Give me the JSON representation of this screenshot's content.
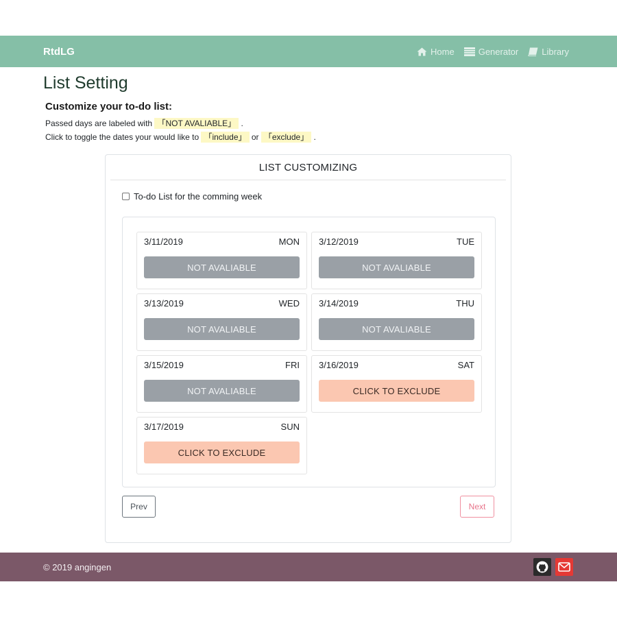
{
  "navbar": {
    "brand": "RtdLG",
    "links": [
      {
        "label": "Home",
        "icon": "home-icon"
      },
      {
        "label": "Generator",
        "icon": "generator-icon"
      },
      {
        "label": "Library",
        "icon": "book-icon"
      }
    ],
    "color": "#85bfa7"
  },
  "page": {
    "title": "List Setting",
    "subheading": "Customize your to-do list:",
    "line1_prefix": "Passed days are labeled with ",
    "line1_highlight": "「NOT AVALIABLE」",
    "line1_suffix": " .",
    "line2_prefix": "Click to toggle the dates your would like to ",
    "line2_highlight1": "「include」",
    "line2_middle": " or ",
    "line2_highlight2": "「exclude」",
    "line2_suffix": " ."
  },
  "card": {
    "header": "LIST CUSTOMIZING",
    "checkbox_label": "To-do List for the comming week",
    "checkbox_checked": false,
    "days": [
      {
        "date": "3/11/2019",
        "weekday": "MON",
        "button": "NOT AVALIABLE",
        "state": "not-available"
      },
      {
        "date": "3/12/2019",
        "weekday": "TUE",
        "button": "NOT AVALIABLE",
        "state": "not-available"
      },
      {
        "date": "3/13/2019",
        "weekday": "WED",
        "button": "NOT AVALIABLE",
        "state": "not-available"
      },
      {
        "date": "3/14/2019",
        "weekday": "THU",
        "button": "NOT AVALIABLE",
        "state": "not-available"
      },
      {
        "date": "3/15/2019",
        "weekday": "FRI",
        "button": "NOT AVALIABLE",
        "state": "not-available"
      },
      {
        "date": "3/16/2019",
        "weekday": "SAT",
        "button": "CLICK TO EXCLUDE",
        "state": "include"
      },
      {
        "date": "3/17/2019",
        "weekday": "SUN",
        "button": "CLICK TO EXCLUDE",
        "state": "include"
      }
    ],
    "prev_label": "Prev",
    "next_label": "Next"
  },
  "footer": {
    "copyright": "© 2019 angingen",
    "icons": [
      "github-icon",
      "mail-icon"
    ],
    "color": "#7b5868"
  }
}
